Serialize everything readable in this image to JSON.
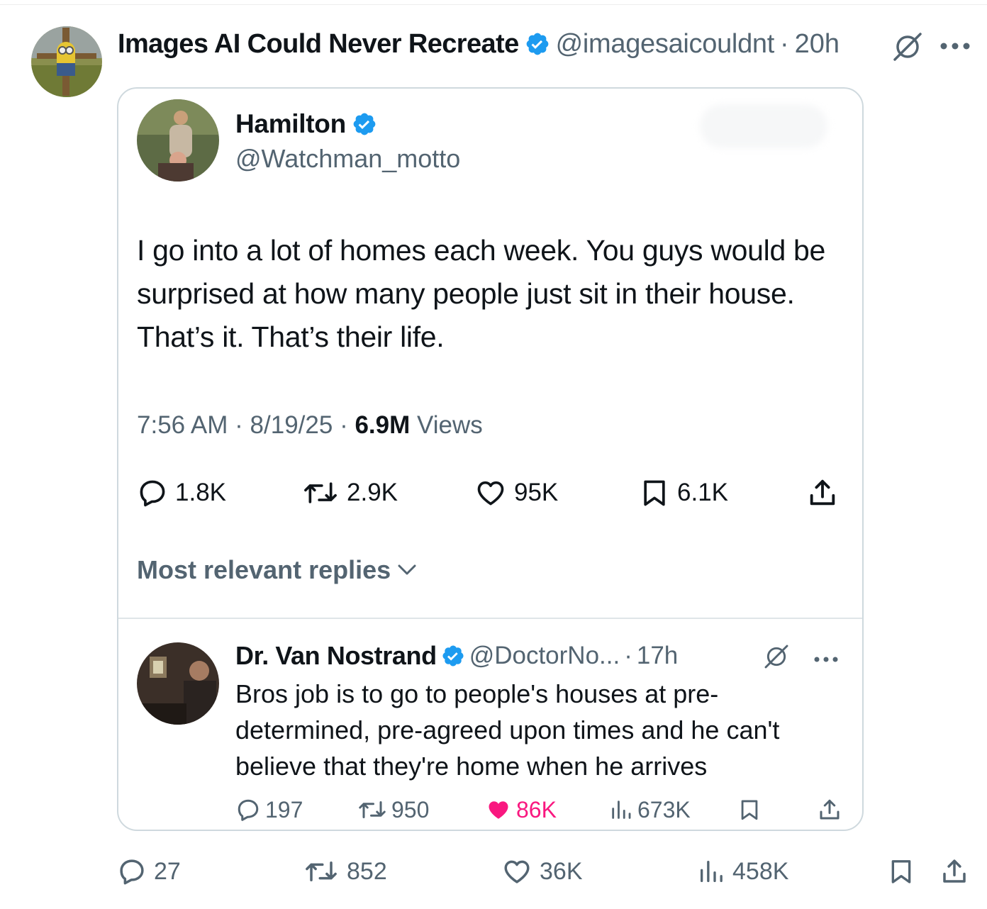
{
  "colors": {
    "verified": "#1d9bf0",
    "text_primary": "#0f1419",
    "text_secondary": "#536471",
    "like_active": "#f91880",
    "border": "#cfd9de"
  },
  "outer": {
    "avatar": "minion-scarecrow-avatar",
    "display_name": "Images AI Could Never Recreate",
    "handle": "@imagesaicouldnt",
    "separator": "·",
    "time": "20h",
    "actions": {
      "replies": "27",
      "reposts": "852",
      "likes": "36K",
      "views": "458K"
    }
  },
  "quoted": {
    "avatar": "man-carrying-child-avatar",
    "display_name": "Hamilton",
    "handle": "@Watchman_motto",
    "text": "I go into a lot of homes each week. You guys would be surprised at how many people just sit in their house. That’s it. That’s their life.",
    "time": "7:56 AM",
    "date": "8/19/25",
    "separator": "·",
    "views_count": "6.9M",
    "views_label": "Views",
    "actions": {
      "replies": "1.8K",
      "reposts": "2.9K",
      "likes": "95K",
      "bookmarks": "6.1K"
    },
    "replies_sort_label": "Most relevant replies"
  },
  "reply": {
    "avatar": "scene-still-avatar",
    "display_name": "Dr. Van Nostrand",
    "handle": "@DoctorNo...",
    "separator": "·",
    "time": "17h",
    "text": "Bros job is to go to people's houses at pre-determined, pre-agreed upon times and he can't believe that they're home when he arrives",
    "actions": {
      "replies": "197",
      "reposts": "950",
      "likes": "86K",
      "views": "673K"
    }
  }
}
